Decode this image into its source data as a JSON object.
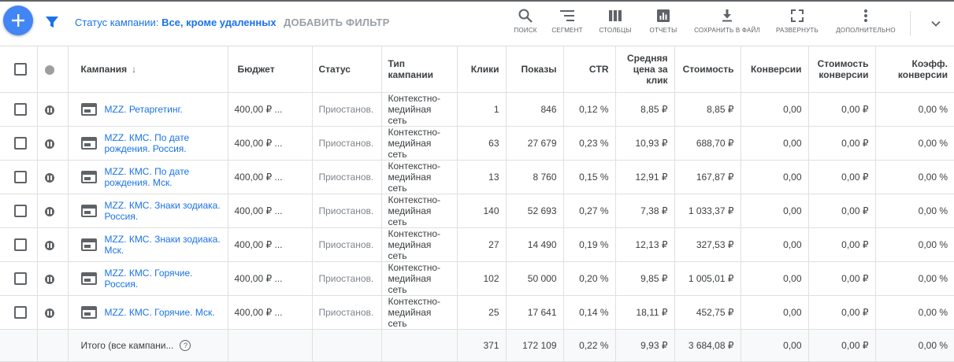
{
  "toolbar": {
    "filter_label": "Статус кампании:",
    "filter_value": "Все, кроме удаленных",
    "add_filter": "ДОБАВИТЬ ФИЛЬТР",
    "buttons": [
      {
        "label": "ПОИСК",
        "icon": "search-icon"
      },
      {
        "label": "СЕГМЕНТ",
        "icon": "segment-icon"
      },
      {
        "label": "СТОЛБЦЫ",
        "icon": "columns-icon"
      },
      {
        "label": "ОТЧЕТЫ",
        "icon": "reports-icon"
      },
      {
        "label": "СОХРАНИТЬ В ФАЙЛ",
        "icon": "download-icon"
      },
      {
        "label": "РАЗВЕРНУТЬ",
        "icon": "fullscreen-icon"
      },
      {
        "label": "ДОПОЛНИТЕЛЬНО",
        "icon": "more-icon"
      }
    ]
  },
  "table": {
    "headers": {
      "campaign": "Кампания",
      "budget": "Бюджет",
      "status": "Статус",
      "type": "Тип кампании",
      "clicks": "Клики",
      "impressions": "Показы",
      "ctr": "CTR",
      "avg_cpc": "Средняя цена за клик",
      "cost": "Стоимость",
      "conversions": "Конверсии",
      "cost_per_conv": "Стоимость конверсии",
      "conv_rate": "Коэфф. конверсии"
    },
    "rows": [
      {
        "campaign": "MZZ. Ретаргетинг.",
        "budget": "400,00 ₽ ...",
        "status": "Приостанов.",
        "type": "Контекстно-медийная сеть",
        "clicks": "1",
        "impressions": "846",
        "ctr": "0,12 %",
        "avg_cpc": "8,85 ₽",
        "cost": "8,85 ₽",
        "conversions": "0,00",
        "cost_per_conv": "0,00 ₽",
        "conv_rate": "0,00 %"
      },
      {
        "campaign": "MZZ. КМС. По дате рождения. Россия.",
        "budget": "400,00 ₽ ...",
        "status": "Приостанов.",
        "type": "Контекстно-медийная сеть",
        "clicks": "63",
        "impressions": "27 679",
        "ctr": "0,23 %",
        "avg_cpc": "10,93 ₽",
        "cost": "688,70 ₽",
        "conversions": "0,00",
        "cost_per_conv": "0,00 ₽",
        "conv_rate": "0,00 %"
      },
      {
        "campaign": "MZZ. КМС. По дате рождения. Мск.",
        "budget": "400,00 ₽ ...",
        "status": "Приостанов.",
        "type": "Контекстно-медийная сеть",
        "clicks": "13",
        "impressions": "8 760",
        "ctr": "0,15 %",
        "avg_cpc": "12,91 ₽",
        "cost": "167,87 ₽",
        "conversions": "0,00",
        "cost_per_conv": "0,00 ₽",
        "conv_rate": "0,00 %"
      },
      {
        "campaign": "MZZ. КМС. Знаки зодиака. Россия.",
        "budget": "400,00 ₽ ...",
        "status": "Приостанов.",
        "type": "Контекстно-медийная сеть",
        "clicks": "140",
        "impressions": "52 693",
        "ctr": "0,27 %",
        "avg_cpc": "7,38 ₽",
        "cost": "1 033,37 ₽",
        "conversions": "0,00",
        "cost_per_conv": "0,00 ₽",
        "conv_rate": "0,00 %"
      },
      {
        "campaign": "MZZ. КМС. Знаки зодиака. Мск.",
        "budget": "400,00 ₽ ...",
        "status": "Приостанов.",
        "type": "Контекстно-медийная сеть",
        "clicks": "27",
        "impressions": "14 490",
        "ctr": "0,19 %",
        "avg_cpc": "12,13 ₽",
        "cost": "327,53 ₽",
        "conversions": "0,00",
        "cost_per_conv": "0,00 ₽",
        "conv_rate": "0,00 %"
      },
      {
        "campaign": "MZZ. КМС. Горячие. Россия.",
        "budget": "400,00 ₽ ...",
        "status": "Приостанов.",
        "type": "Контекстно-медийная сеть",
        "clicks": "102",
        "impressions": "50 000",
        "ctr": "0,20 %",
        "avg_cpc": "9,85 ₽",
        "cost": "1 005,01 ₽",
        "conversions": "0,00",
        "cost_per_conv": "0,00 ₽",
        "conv_rate": "0,00 %"
      },
      {
        "campaign": "MZZ. КМС. Горячие. Мск.",
        "budget": "400,00 ₽ ...",
        "status": "Приостанов.",
        "type": "Контекстно-медийная сеть",
        "clicks": "25",
        "impressions": "17 641",
        "ctr": "0,14 %",
        "avg_cpc": "18,11 ₽",
        "cost": "452,75 ₽",
        "conversions": "0,00",
        "cost_per_conv": "0,00 ₽",
        "conv_rate": "0,00 %"
      }
    ],
    "total": {
      "label": "Итого (все кампани...",
      "clicks": "371",
      "impressions": "172 109",
      "ctr": "0,22 %",
      "avg_cpc": "9,93 ₽",
      "cost": "3 684,08 ₽",
      "conversions": "0,00",
      "cost_per_conv": "0,00 ₽",
      "conv_rate": "0,00 %"
    }
  }
}
